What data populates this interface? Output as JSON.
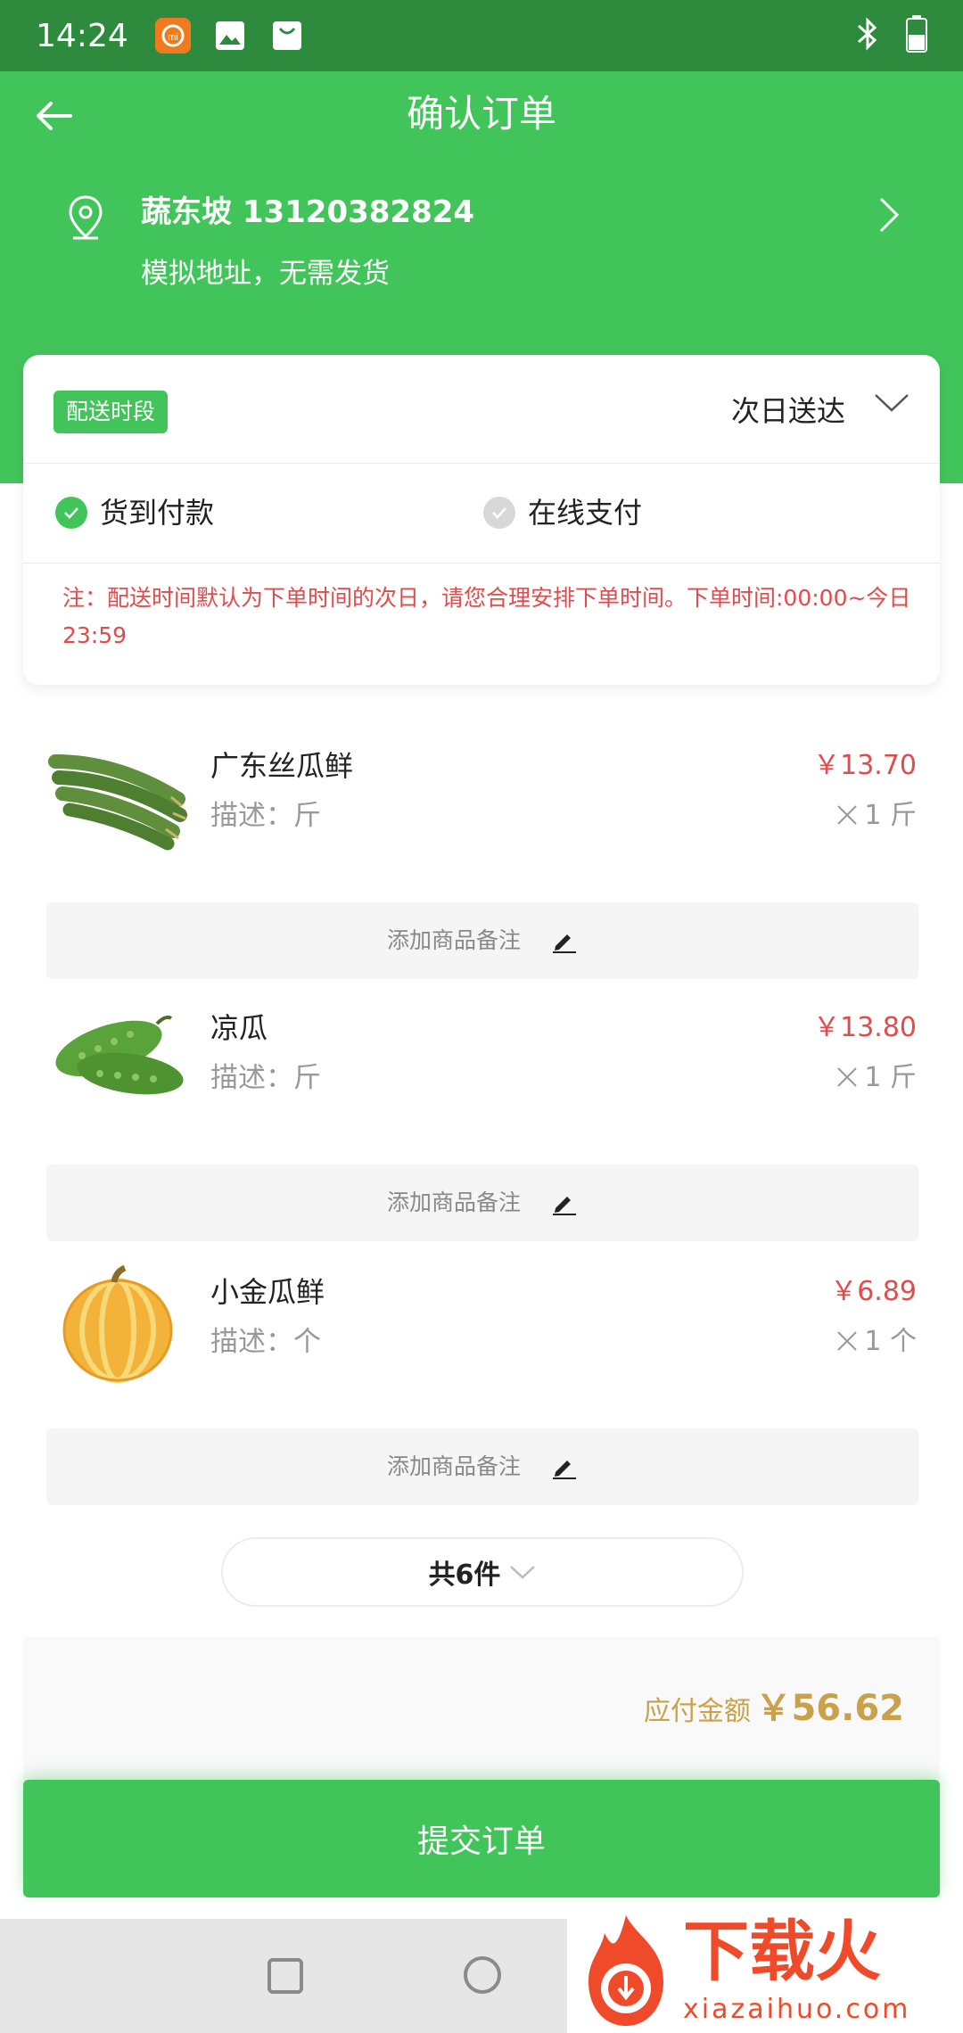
{
  "status_bar": {
    "time": "14:24",
    "icons": [
      "mi-app-icon",
      "gallery-icon",
      "bag-icon"
    ],
    "right_icons": [
      "bluetooth-icon",
      "battery-icon"
    ]
  },
  "header": {
    "title": "确认订单",
    "back_icon": "arrow-left-icon"
  },
  "address": {
    "name_phone": "蔬东坡 13120382824",
    "detail": "模拟地址，无需发货"
  },
  "delivery": {
    "badge": "配送时段",
    "value": "次日送达"
  },
  "payment": {
    "options": [
      {
        "label": "货到付款",
        "selected": true
      },
      {
        "label": "在线支付",
        "selected": false
      }
    ]
  },
  "note": "注：配送时间默认为下单时间的次日，请您合理安排下单时间。下单时间:00:00~今日23:59",
  "products": [
    {
      "name": "广东丝瓜鲜",
      "desc": "描述：斤",
      "price": "￥13.70",
      "qty": "1 斤",
      "remark": "添加商品备注",
      "image": "luffa-image"
    },
    {
      "name": "凉瓜",
      "desc": "描述：斤",
      "price": "￥13.80",
      "qty": "1 斤",
      "remark": "添加商品备注",
      "image": "bitter-melon-image"
    },
    {
      "name": "小金瓜鲜",
      "desc": "描述：个",
      "price": "￥6.89",
      "qty": "1 个",
      "remark": "添加商品备注",
      "image": "pumpkin-image"
    }
  ],
  "summary": {
    "count_label": "共6件",
    "amount_label": "应付金额",
    "amount_value": "￥56.62"
  },
  "submit_label": "提交订单",
  "watermark": {
    "title": "下载火",
    "subtitle": "xiazaihuo.com"
  },
  "colors": {
    "brand_green": "#41c55a",
    "price_red": "#e24b4b",
    "amount_gold": "#c9a14a"
  }
}
